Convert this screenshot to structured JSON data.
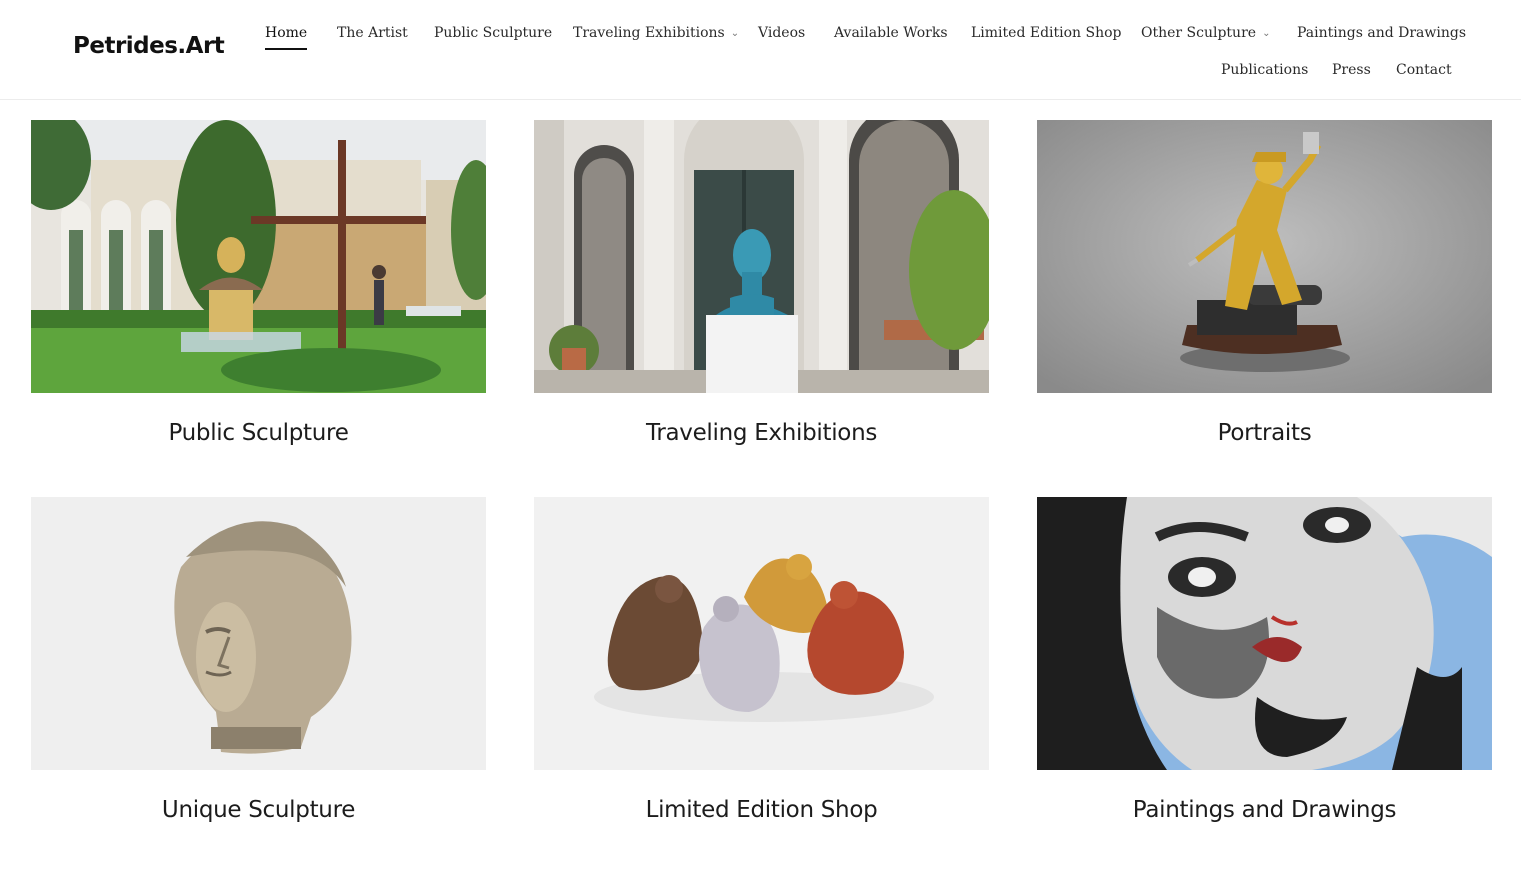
{
  "site": {
    "logo": "Petrides.Art"
  },
  "nav": {
    "row1": [
      {
        "label": "Home",
        "active": true
      },
      {
        "label": "The Artist"
      },
      {
        "label": "Public Sculpture"
      },
      {
        "label": "Traveling Exhibitions",
        "dropdown": true
      },
      {
        "label": "Videos"
      },
      {
        "label": "Available Works"
      },
      {
        "label": "Limited Edition Shop"
      },
      {
        "label": "Other Sculpture",
        "dropdown": true
      },
      {
        "label": "Paintings and Drawings"
      }
    ],
    "row2": [
      {
        "label": "Publications"
      },
      {
        "label": "Press"
      },
      {
        "label": "Contact"
      }
    ],
    "caret_icon": "chevron-down-icon"
  },
  "gallery": [
    {
      "title": "Public Sculpture",
      "image": "bust-and-cross-garden-photo"
    },
    {
      "title": "Traveling Exhibitions",
      "image": "blue-bust-at-building-entrance-photo"
    },
    {
      "title": "Portraits",
      "image": "gold-pirate-statue-photo"
    },
    {
      "title": "Unique Sculpture",
      "image": "stone-head-sculpture-photo"
    },
    {
      "title": "Limited Edition Shop",
      "image": "four-crouching-figures-photo"
    },
    {
      "title": "Paintings and Drawings",
      "image": "expressive-face-painting-photo"
    }
  ]
}
